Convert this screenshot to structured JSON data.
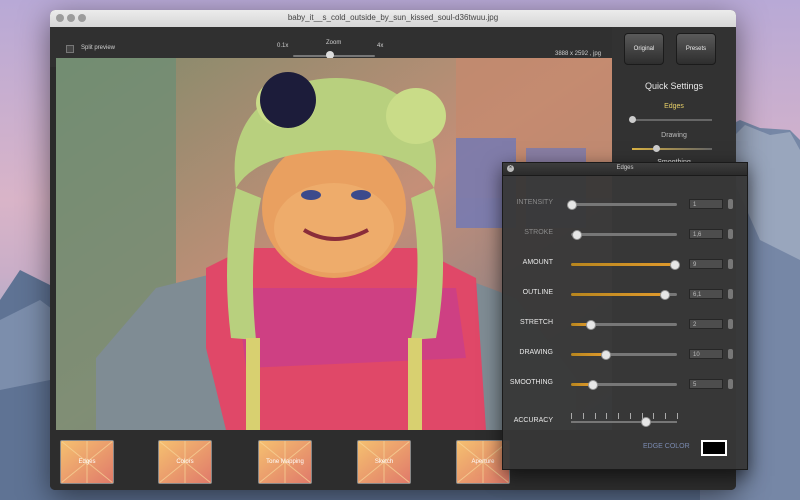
{
  "window": {
    "title": "baby_it__s_cold_outside_by_sun_kissed_soul-d36twuu.jpg"
  },
  "toolbar": {
    "split_preview": "Split preview",
    "zoom_label": "Zoom",
    "zoom_min": "0.1x",
    "zoom_max": "4x",
    "zoom_level": 0.45,
    "image_info": "3888 x 2592 , jpg"
  },
  "sidebar": {
    "original_button": "Original",
    "presets_button": "Presets",
    "quick_settings_title": "Quick Settings",
    "edges_label": "Edges",
    "drawing_label": "Drawing",
    "smoothing_label": "Smoothing",
    "edges_level": 0.0,
    "drawing_level": 0.3
  },
  "presets": [
    {
      "label": "Edges"
    },
    {
      "label": "Colors"
    },
    {
      "label": "Tone Mapping"
    },
    {
      "label": "Sketch"
    },
    {
      "label": "Aperture"
    }
  ],
  "edges_panel": {
    "title": "Edges",
    "rows": [
      {
        "label": "INTENSITY",
        "value": "1",
        "level": 0.0,
        "active": false
      },
      {
        "label": "STROKE",
        "value": "1,6",
        "level": 0.05,
        "active": false
      },
      {
        "label": "AMOUNT",
        "value": "9",
        "level": 0.97,
        "active": true
      },
      {
        "label": "OUTLINE",
        "value": "6,1",
        "level": 0.88,
        "active": true
      },
      {
        "label": "STRETCH",
        "value": "2",
        "level": 0.18,
        "active": true
      },
      {
        "label": "DRAWING",
        "value": "10",
        "level": 0.32,
        "active": true
      },
      {
        "label": "SMOOTHING",
        "value": "5",
        "level": 0.2,
        "active": true
      }
    ],
    "accuracy_label": "ACCURACY",
    "accuracy_level": 0.7,
    "edge_color_label": "EDGE COLOR",
    "edge_color": "#000000"
  }
}
